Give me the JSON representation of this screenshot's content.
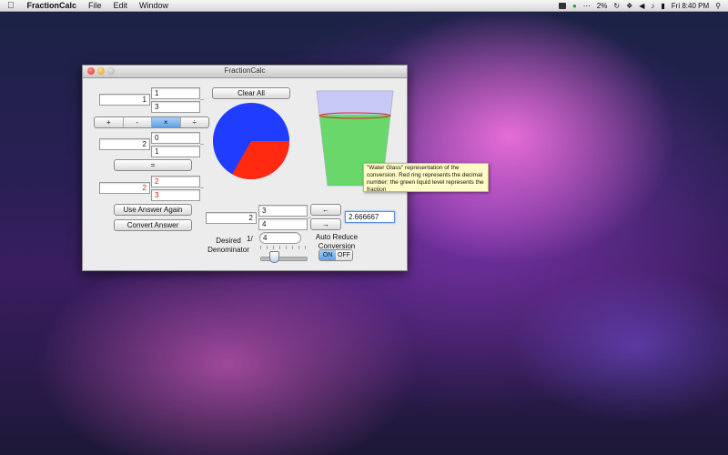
{
  "menubar": {
    "app": "FractionCalc",
    "menus": [
      "File",
      "Edit",
      "Window"
    ],
    "battery": "2%",
    "clock": "Fri 8:40 PM"
  },
  "window": {
    "title": "FractionCalc",
    "top_fraction": {
      "whole": "1",
      "numerator": "1",
      "denominator": "3"
    },
    "operators": [
      "+",
      "-",
      "×",
      "÷"
    ],
    "selected_operator": "×",
    "second_fraction": {
      "whole": "2",
      "numerator": "0",
      "denominator": "1"
    },
    "equals_label": "=",
    "result_fraction": {
      "whole": "2",
      "numerator": "2",
      "denominator": "3"
    },
    "clear_all_label": "Clear All",
    "use_answer_again_label": "Use Answer Again",
    "convert_answer_label": "Convert Answer",
    "converted_fraction": {
      "whole": "2",
      "numerator": "3",
      "denominator": "4"
    },
    "left_arrow_label": "←",
    "right_arrow_label": "→",
    "decimal_value": "2.666667",
    "desired_denominator_label": "Desired\nDenominator",
    "denominator_prefix": "1/",
    "denominator_value": "4",
    "auto_reduce_label": "Auto Reduce\nConversion",
    "toggle_on": "ON",
    "toggle_off": "OFF"
  },
  "tooltip": {
    "text": "\"Water Glass\" representation of the conversion.  Red ring represents the decimal number; the green liquid level represents the fraction"
  },
  "colors": {
    "pie_blue": "#1f3cff",
    "pie_red": "#ff2a10",
    "glass_green": "#6ad76a",
    "red_text": "#e01010"
  },
  "pie_red_fraction": 0.333,
  "glass_fill_fraction": 0.75
}
